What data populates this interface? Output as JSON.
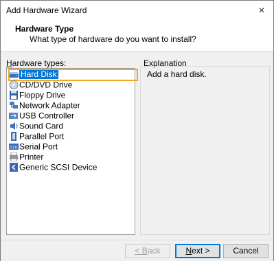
{
  "window": {
    "title": "Add Hardware Wizard",
    "close": "×"
  },
  "header": {
    "title": "Hardware Type",
    "subtitle": "What type of hardware do you want to install?"
  },
  "hardware": {
    "label": "Hardware types:",
    "items": [
      {
        "label": "Hard Disk",
        "icon": "hard-disk-icon",
        "selected": true
      },
      {
        "label": "CD/DVD Drive",
        "icon": "cd-dvd-icon"
      },
      {
        "label": "Floppy Drive",
        "icon": "floppy-icon"
      },
      {
        "label": "Network Adapter",
        "icon": "network-adapter-icon"
      },
      {
        "label": "USB Controller",
        "icon": "usb-controller-icon"
      },
      {
        "label": "Sound Card",
        "icon": "sound-card-icon"
      },
      {
        "label": "Parallel Port",
        "icon": "parallel-port-icon"
      },
      {
        "label": "Serial Port",
        "icon": "serial-port-icon"
      },
      {
        "label": "Printer",
        "icon": "printer-icon"
      },
      {
        "label": "Generic SCSI Device",
        "icon": "scsi-device-icon"
      }
    ]
  },
  "explanation": {
    "label": "Explanation",
    "text": "Add a hard disk."
  },
  "buttons": {
    "back": "< Back",
    "next": "Next >",
    "cancel": "Cancel"
  }
}
